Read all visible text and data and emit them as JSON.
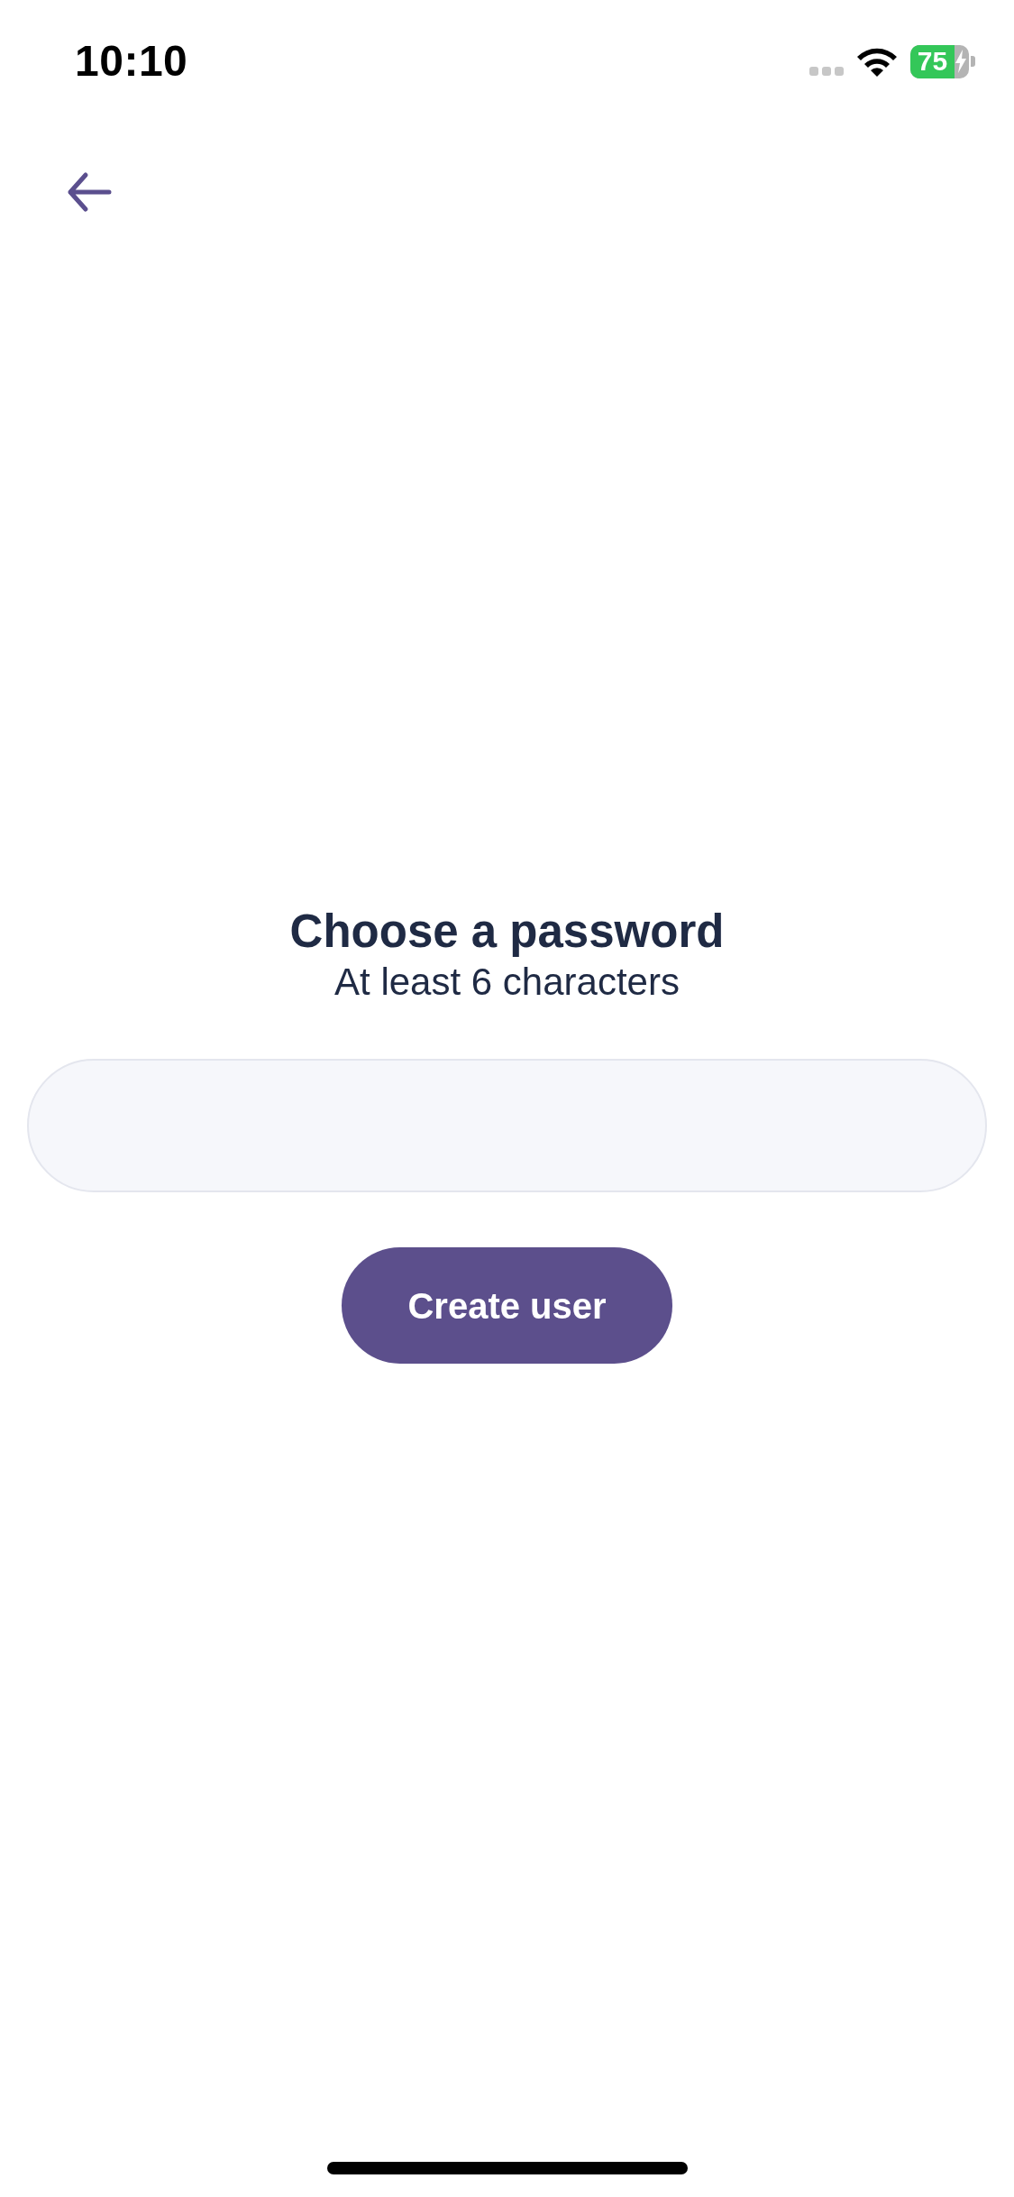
{
  "status_bar": {
    "time": "10:10",
    "battery": "75",
    "charging": true
  },
  "heading": "Choose a password",
  "subtitle": "At least 6 characters",
  "create_button": {
    "label": "Create user"
  }
}
